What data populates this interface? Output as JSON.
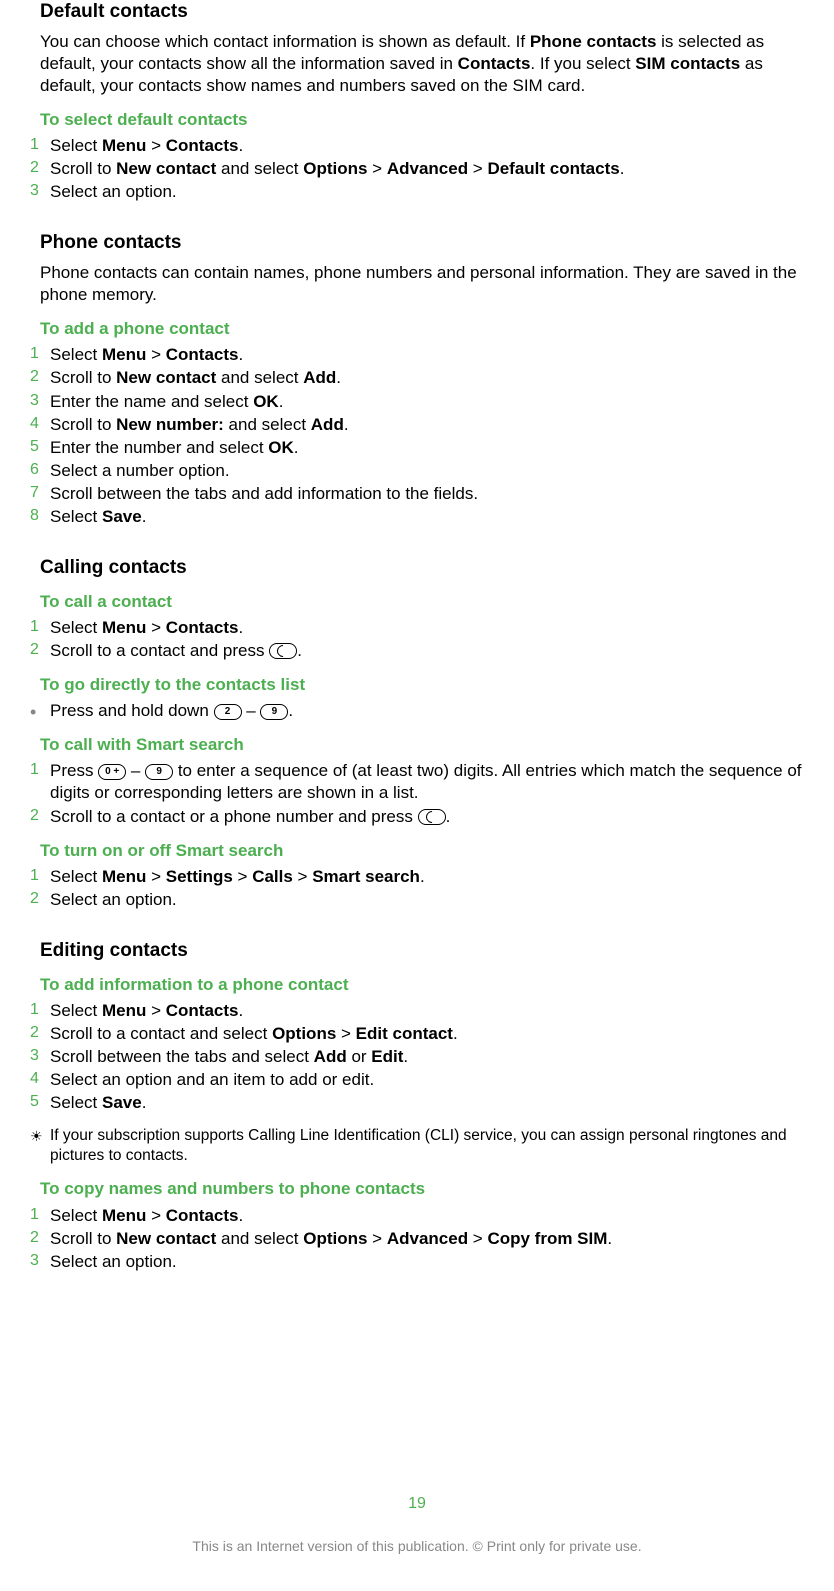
{
  "s1": {
    "heading": "Default contacts",
    "para_parts": {
      "p1": "You can choose which contact information is shown as default. If ",
      "b1": "Phone contacts",
      "p2": " is selected as default, your contacts show all the information saved in ",
      "b2": "Contacts",
      "p3": ". If you select ",
      "b3": "SIM contacts",
      "p4": " as default, your contacts show names and numbers saved on the SIM card."
    },
    "sub": "To select default contacts",
    "steps": [
      {
        "n": "1",
        "pre": "Select ",
        "b1": "Menu",
        "mid1": " > ",
        "b2": "Contacts",
        "post": "."
      },
      {
        "n": "2",
        "pre": "Scroll to ",
        "b1": "New contact",
        "mid1": " and select ",
        "b2": "Options",
        "mid2": " > ",
        "b3": "Advanced",
        "mid3": " > ",
        "b4": "Default contacts",
        "post": "."
      },
      {
        "n": "3",
        "pre": "Select an option."
      }
    ]
  },
  "s2": {
    "heading": "Phone contacts",
    "para": "Phone contacts can contain names, phone numbers and personal information. They are saved in the phone memory.",
    "sub": "To add a phone contact",
    "steps": [
      {
        "n": "1",
        "pre": "Select ",
        "b1": "Menu",
        "mid1": " > ",
        "b2": "Contacts",
        "post": "."
      },
      {
        "n": "2",
        "pre": "Scroll to ",
        "b1": "New contact",
        "mid1": " and select ",
        "b2": "Add",
        "post": "."
      },
      {
        "n": "3",
        "pre": "Enter the name and select ",
        "b1": "OK",
        "post": "."
      },
      {
        "n": "4",
        "pre": "Scroll to ",
        "b1": "New number:",
        "mid1": " and select ",
        "b2": "Add",
        "post": "."
      },
      {
        "n": "5",
        "pre": "Enter the number and select ",
        "b1": "OK",
        "post": "."
      },
      {
        "n": "6",
        "pre": "Select a number option."
      },
      {
        "n": "7",
        "pre": "Scroll between the tabs and add information to the fields."
      },
      {
        "n": "8",
        "pre": "Select ",
        "b1": "Save",
        "post": "."
      }
    ]
  },
  "s3": {
    "heading": "Calling contacts",
    "sub_a": "To call a contact",
    "steps_a": [
      {
        "n": "1",
        "pre": "Select ",
        "b1": "Menu",
        "mid1": " > ",
        "b2": "Contacts",
        "post": "."
      },
      {
        "n": "2",
        "pre": "Scroll to a contact and press ",
        "icon": "call",
        "post": "."
      }
    ],
    "sub_b": "To go directly to the contacts list",
    "bullet_b": {
      "pre": "Press and hold down ",
      "k1": "2",
      "mid": " – ",
      "k2": "9",
      "post": "."
    },
    "sub_c": "To call with Smart search",
    "steps_c": [
      {
        "n": "1",
        "pre": "Press ",
        "k1": "0 +",
        "mid": " – ",
        "k2": "9",
        "post": " to enter a sequence of (at least two) digits. All entries which match the sequence of digits or corresponding letters are shown in a list."
      },
      {
        "n": "2",
        "pre": "Scroll to a contact or a phone number and press ",
        "icon": "call",
        "post": "."
      }
    ],
    "sub_d": "To turn on or off Smart search",
    "steps_d": [
      {
        "n": "1",
        "pre": "Select ",
        "b1": "Menu",
        "mid1": " > ",
        "b2": "Settings",
        "mid2": " > ",
        "b3": "Calls",
        "mid3": " > ",
        "b4": "Smart search",
        "post": "."
      },
      {
        "n": "2",
        "pre": "Select an option."
      }
    ]
  },
  "s4": {
    "heading": "Editing contacts",
    "sub_a": "To add information to a phone contact",
    "steps_a": [
      {
        "n": "1",
        "pre": "Select ",
        "b1": "Menu",
        "mid1": " > ",
        "b2": "Contacts",
        "post": "."
      },
      {
        "n": "2",
        "pre": "Scroll to a contact and select ",
        "b1": "Options",
        "mid1": " > ",
        "b2": "Edit contact",
        "post": "."
      },
      {
        "n": "3",
        "pre": "Scroll between the tabs and select ",
        "b1": "Add",
        "mid1": " or ",
        "b2": "Edit",
        "post": "."
      },
      {
        "n": "4",
        "pre": "Select an option and an item to add or edit."
      },
      {
        "n": "5",
        "pre": "Select ",
        "b1": "Save",
        "post": "."
      }
    ],
    "tip": "If your subscription supports Calling Line Identification (CLI) service, you can assign personal ringtones and pictures to contacts.",
    "sub_b": "To copy names and numbers to phone contacts",
    "steps_b": [
      {
        "n": "1",
        "pre": "Select ",
        "b1": "Menu",
        "mid1": " > ",
        "b2": "Contacts",
        "post": "."
      },
      {
        "n": "2",
        "pre": "Scroll to ",
        "b1": "New contact",
        "mid1": " and select ",
        "b2": "Options",
        "mid2": " > ",
        "b3": "Advanced",
        "mid3": " > ",
        "b4": "Copy from SIM",
        "post": "."
      },
      {
        "n": "3",
        "pre": "Select an option."
      }
    ]
  },
  "footer": {
    "page": "19",
    "note": "This is an Internet version of this publication. © Print only for private use."
  }
}
